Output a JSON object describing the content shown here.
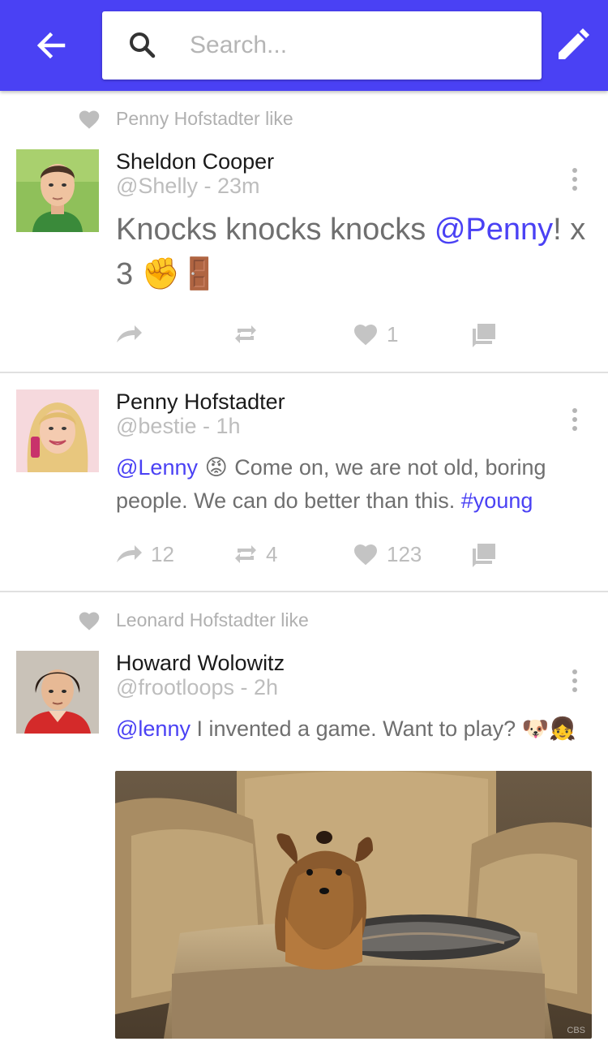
{
  "header": {
    "search_placeholder": "Search...",
    "accent_color": "#4a41f4"
  },
  "tweets": [
    {
      "liked_by": "Penny Hofstadter like",
      "author": "Sheldon Cooper",
      "meta": "@Shelly - 23m",
      "text_parts": [
        "Knocks knocks knocks ",
        "@Penny",
        "! x 3 ",
        "✊🚪"
      ],
      "actions": {
        "reply_count": "",
        "retweet_count": "",
        "like_count": "1",
        "comment_count": ""
      },
      "avatar_icon": "person-avatar"
    },
    {
      "liked_by": "",
      "author": "Penny Hofstadter",
      "meta": "@bestie - 1h",
      "text_parts": [
        "@Lenny",
        " 😡 ",
        "Come on, we are not old, boring people. We can do better than this. ",
        "#young"
      ],
      "actions": {
        "reply_count": "12",
        "retweet_count": "4",
        "like_count": "123",
        "comment_count": ""
      },
      "avatar_icon": "person-avatar"
    },
    {
      "liked_by": "Leonard Hofstadter like",
      "author": "Howard Wolowitz",
      "meta": "@frootloops - 2h",
      "text_parts": [
        "@lenny",
        " I invented a game. Want to play? ",
        "🐶👧"
      ],
      "actions": {
        "reply_count": "",
        "retweet_count": "",
        "like_count": "",
        "comment_count": ""
      },
      "avatar_icon": "person-avatar",
      "media": {
        "watermark": "CBS"
      }
    }
  ]
}
